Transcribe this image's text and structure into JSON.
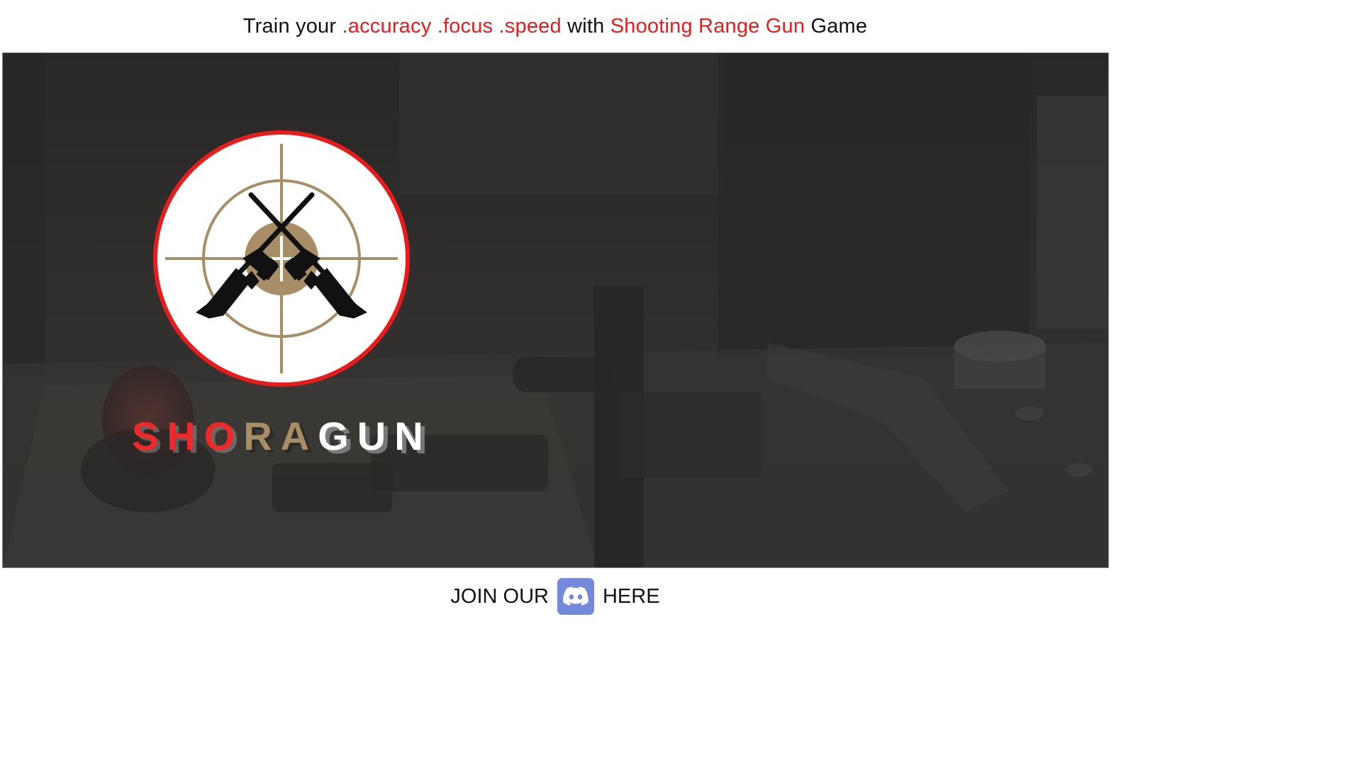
{
  "header": {
    "prefix": "Train your ",
    "accuracy": ".accuracy",
    "focus": ".focus",
    "speed": ".speed",
    "with": " with ",
    "game_name": "Shooting Range Gun",
    "suffix": " Game"
  },
  "hero": {
    "wordmark": {
      "part1": "SHO",
      "part2": "RA",
      "part3": "GUN"
    }
  },
  "footer": {
    "join_label": "JOIN OUR",
    "here_label": "HERE"
  },
  "icons": {
    "discord": "discord-icon",
    "emblem": "crosshair-crossed-rifles-emblem"
  },
  "colors": {
    "accent_red": "#e81c1c",
    "gold": "#a88e66",
    "discord_blue": "#7389da",
    "hero_dark": "#3a3a3a"
  }
}
